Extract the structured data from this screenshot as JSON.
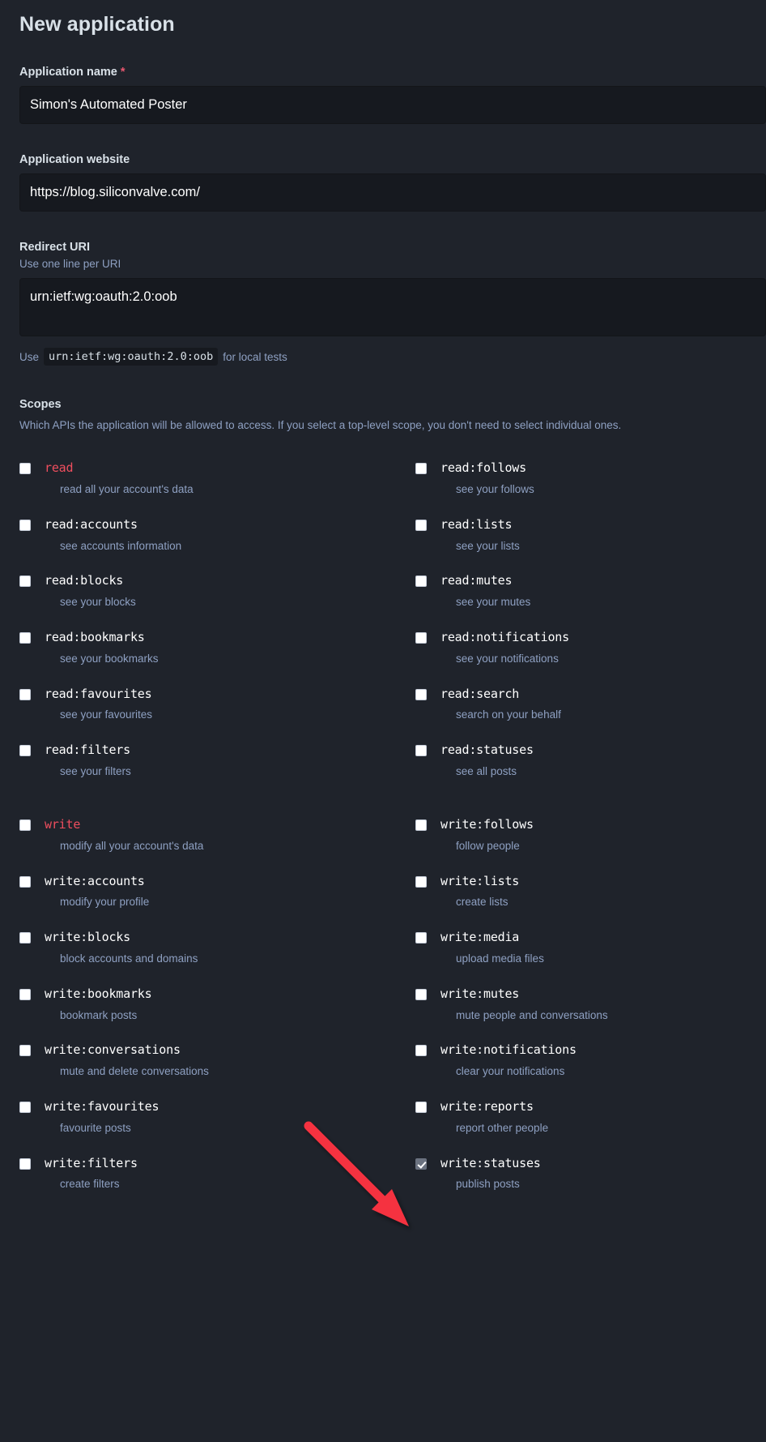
{
  "page": {
    "title": "New application"
  },
  "form": {
    "app_name": {
      "label": "Application name",
      "required_marker": "*",
      "value": "Simon's Automated Poster"
    },
    "app_website": {
      "label": "Application website",
      "value": "https://blog.siliconvalve.com/"
    },
    "redirect_uri": {
      "label": "Redirect URI",
      "hint": "Use one line per URI",
      "value": "urn:ietf:wg:oauth:2.0:oob",
      "local_test_prefix": "Use",
      "local_test_code": "urn:ietf:wg:oauth:2.0:oob",
      "local_test_suffix": "for local tests"
    }
  },
  "scopes": {
    "heading": "Scopes",
    "description": "Which APIs the application will be allowed to access. If you select a top-level scope, you don't need to select individual ones.",
    "danger_color": "#ef4e5e",
    "read_left": [
      {
        "name": "read",
        "desc": "read all your account's data",
        "checked": false,
        "toplevel": true
      },
      {
        "name": "read:accounts",
        "desc": "see accounts information",
        "checked": false,
        "toplevel": false
      },
      {
        "name": "read:blocks",
        "desc": "see your blocks",
        "checked": false,
        "toplevel": false
      },
      {
        "name": "read:bookmarks",
        "desc": "see your bookmarks",
        "checked": false,
        "toplevel": false
      },
      {
        "name": "read:favourites",
        "desc": "see your favourites",
        "checked": false,
        "toplevel": false
      },
      {
        "name": "read:filters",
        "desc": "see your filters",
        "checked": false,
        "toplevel": false
      }
    ],
    "read_right": [
      {
        "name": "read:follows",
        "desc": "see your follows",
        "checked": false,
        "toplevel": false
      },
      {
        "name": "read:lists",
        "desc": "see your lists",
        "checked": false,
        "toplevel": false
      },
      {
        "name": "read:mutes",
        "desc": "see your mutes",
        "checked": false,
        "toplevel": false
      },
      {
        "name": "read:notifications",
        "desc": "see your notifications",
        "checked": false,
        "toplevel": false
      },
      {
        "name": "read:search",
        "desc": "search on your behalf",
        "checked": false,
        "toplevel": false
      },
      {
        "name": "read:statuses",
        "desc": "see all posts",
        "checked": false,
        "toplevel": false
      }
    ],
    "write_left": [
      {
        "name": "write",
        "desc": "modify all your account's data",
        "checked": false,
        "toplevel": true
      },
      {
        "name": "write:accounts",
        "desc": "modify your profile",
        "checked": false,
        "toplevel": false
      },
      {
        "name": "write:blocks",
        "desc": "block accounts and domains",
        "checked": false,
        "toplevel": false
      },
      {
        "name": "write:bookmarks",
        "desc": "bookmark posts",
        "checked": false,
        "toplevel": false
      },
      {
        "name": "write:conversations",
        "desc": "mute and delete conversations",
        "checked": false,
        "toplevel": false
      },
      {
        "name": "write:favourites",
        "desc": "favourite posts",
        "checked": false,
        "toplevel": false
      },
      {
        "name": "write:filters",
        "desc": "create filters",
        "checked": false,
        "toplevel": false
      }
    ],
    "write_right": [
      {
        "name": "write:follows",
        "desc": "follow people",
        "checked": false,
        "toplevel": false
      },
      {
        "name": "write:lists",
        "desc": "create lists",
        "checked": false,
        "toplevel": false
      },
      {
        "name": "write:media",
        "desc": "upload media files",
        "checked": false,
        "toplevel": false
      },
      {
        "name": "write:mutes",
        "desc": "mute people and conversations",
        "checked": false,
        "toplevel": false
      },
      {
        "name": "write:notifications",
        "desc": "clear your notifications",
        "checked": false,
        "toplevel": false
      },
      {
        "name": "write:reports",
        "desc": "report other people",
        "checked": false,
        "toplevel": false
      },
      {
        "name": "write:statuses",
        "desc": "publish posts",
        "checked": true,
        "toplevel": false
      }
    ]
  },
  "annotation": {
    "arrow_color": "#f5333f",
    "points_to": "write:statuses"
  }
}
